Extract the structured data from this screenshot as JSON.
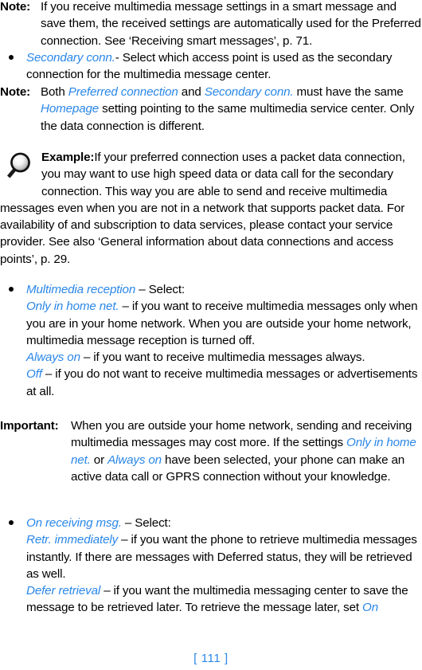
{
  "document": {
    "page_number_label": "[ 111 ]",
    "accent_color": "#2a87e8",
    "text_color": "#000000",
    "background_color": "#ffffff"
  },
  "icons": {
    "example_icon_name": "magnifier-icon"
  },
  "blocks": {
    "note1": {
      "label": "Note:",
      "text": "If you receive multimedia message settings in a smart message and save them, the received settings are automatically used for the Preferred connection. See ‘Receiving smart messages’, p. 71."
    },
    "bullet_secondary_conn": {
      "term": "Secondary conn.",
      "text": "- Select which access point is used as the secondary connection for the multimedia message center."
    },
    "note2": {
      "label": "Note:",
      "text_part1": "Both ",
      "term1": "Preferred connection",
      "text_part2": " and ",
      "term2": "Secondary conn.",
      "text_part3": " must have the same ",
      "term3": "Homepage",
      "text_part4": " setting pointing to the same multimedia service center. Only the data connection is different."
    },
    "example": {
      "label": "Example:",
      "text": "If your preferred connection uses a packet data connection, you may want to use high speed data or data call for the secondary connection. This way you are able to send and receive multimedia messages even when you are not in a network that supports packet data. For availability of and subscription to data services, please contact your service provider. See also ‘General information about data connections and access points’, p. 29."
    },
    "bullet_multimedia_reception": {
      "term": "Multimedia reception",
      "intro": " – Select:",
      "options": [
        {
          "term": "Only in home net.",
          "text": " – if you want to receive multimedia messages only when you are in your home network. When you are outside your home network, multimedia message reception is turned off."
        },
        {
          "term": "Always on",
          "text": " – if you want to receive multimedia messages always."
        },
        {
          "term": "Off",
          "text": " – if you do not want to receive multimedia messages or advertisements at all."
        }
      ]
    },
    "important": {
      "label": "Important:",
      "text_part1": "When you are outside your home network, sending and receiving multimedia messages may cost more. If the settings ",
      "term1": "Only in home net.",
      "text_part2": " or ",
      "term2": "Always on",
      "text_part3": " have been selected, your phone can make an active data call or GPRS connection without your knowledge."
    },
    "bullet_on_receiving_msg": {
      "term": "On receiving msg.",
      "intro": " – Select:",
      "options": [
        {
          "term": "Retr. immediately",
          "text": " – if you want the phone to retrieve multimedia messages instantly. If there are messages with Deferred status, they will be retrieved as well."
        },
        {
          "term": "Defer retrieval",
          "text_part1": " – if you want the multimedia messaging center to save the message to be retrieved later. To retrieve the message later, set ",
          "term_trailing": "On"
        }
      ]
    }
  }
}
